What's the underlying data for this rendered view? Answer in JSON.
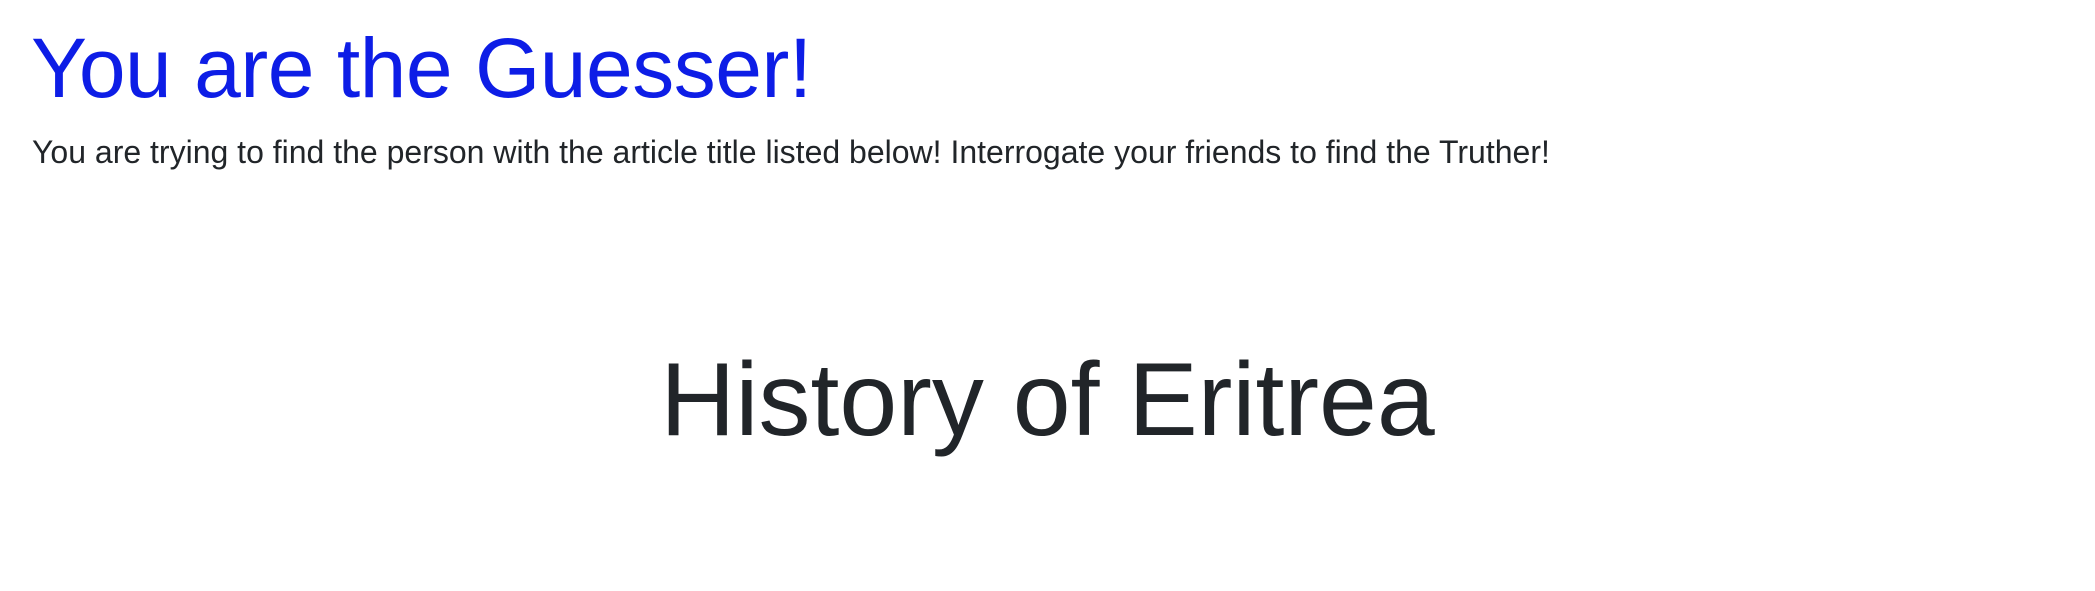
{
  "header": {
    "role_title": "You are the Guesser!",
    "instructions": "You are trying to find the person with the article title listed below! Interrogate your friends to find the Truther!"
  },
  "main": {
    "article_title": "History of Eritrea"
  },
  "colors": {
    "heading": "#0d1de6",
    "text": "#212529",
    "background": "#ffffff"
  }
}
